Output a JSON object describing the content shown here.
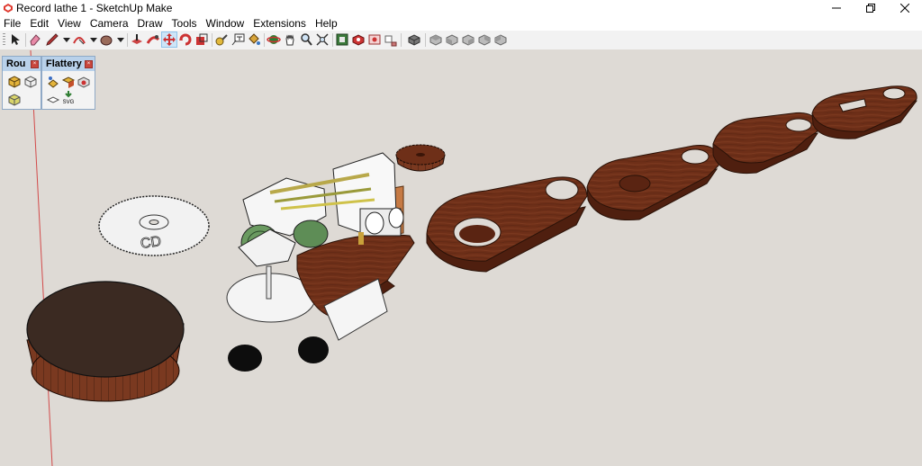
{
  "window": {
    "title": "Record lathe 1 - SketchUp Make",
    "minimize_label": "minimize",
    "maximize_label": "restore",
    "close_label": "close"
  },
  "menu": [
    "File",
    "Edit",
    "View",
    "Camera",
    "Draw",
    "Tools",
    "Window",
    "Extensions",
    "Help"
  ],
  "toolbar": {
    "tools": [
      "select-icon",
      "eraser-icon",
      "pencil-icon",
      "arc-icon",
      "circle-icon",
      "push-pull-icon",
      "follow-me-icon",
      "move-icon",
      "rotate-icon",
      "scale-icon",
      "tape-measure-icon",
      "text-icon",
      "paint-bucket-icon",
      "orbit-icon",
      "pan-icon",
      "zoom-icon",
      "zoom-extents-icon",
      "3d-warehouse-icon",
      "extension-warehouse-icon",
      "layout-icon",
      "components-icon",
      "views-iso-icon",
      "views-top-icon",
      "views-front-icon",
      "views-right-icon",
      "views-back-icon",
      "views-left-icon"
    ],
    "active_tool": "move-icon"
  },
  "palettes": [
    {
      "title": "Rou",
      "tools": [
        "round-corner-icon",
        "round-edges-icon",
        "round-faces-icon"
      ]
    },
    {
      "title": "Flattery",
      "tools": [
        "flatten-icon",
        "unfold-icon",
        "tabs-icon",
        "export-icon",
        "svg-export-icon"
      ],
      "svg_label": "SVG"
    }
  ],
  "canvas": {
    "background": "#dedad5",
    "wood": "#6e2f18",
    "wood_side": "#5a2412",
    "disc_label": "CD"
  }
}
